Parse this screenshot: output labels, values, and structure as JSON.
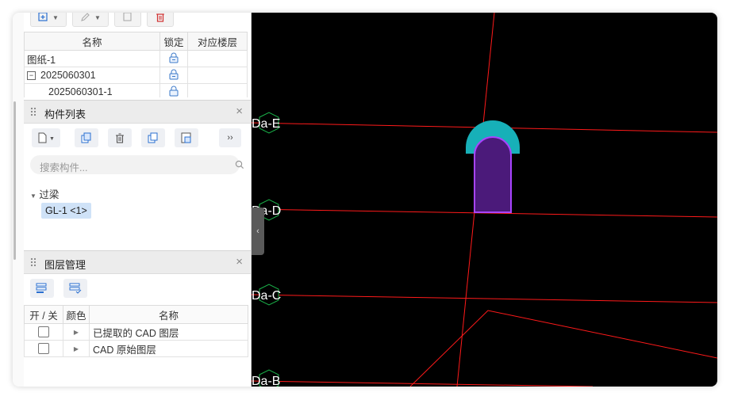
{
  "drawing_panel": {
    "columns": {
      "name": "名称",
      "lock": "锁定",
      "floor": "对应楼层"
    },
    "rows": [
      {
        "name": "图纸-1",
        "expander": ""
      },
      {
        "name": "2025060301",
        "expander": "−"
      },
      {
        "name": "2025060301-1",
        "expander": ""
      }
    ]
  },
  "component_panel": {
    "title": "构件列表",
    "close": "×",
    "search_placeholder": "搜索构件...",
    "expand_more": "››",
    "tree": {
      "category": "过梁",
      "item": "GL-1 <1>"
    }
  },
  "layer_panel": {
    "title": "图层管理",
    "close": "×",
    "columns": {
      "toggle": "开 / 关",
      "color": "颜色",
      "name": "名称"
    },
    "rows": [
      {
        "name": "已提取的 CAD 图层"
      },
      {
        "name": "CAD 原始图层"
      }
    ]
  },
  "canvas": {
    "axis_labels": [
      "Da-E",
      "Da-D",
      "Da-C",
      "Da-B"
    ],
    "collapse": "‹",
    "colors": {
      "background": "#000000",
      "axis": "#ff1a1a",
      "arch_fill": "#4b1a7a",
      "arch_outline": "#a844ff",
      "cap": "#17b0b8"
    }
  }
}
